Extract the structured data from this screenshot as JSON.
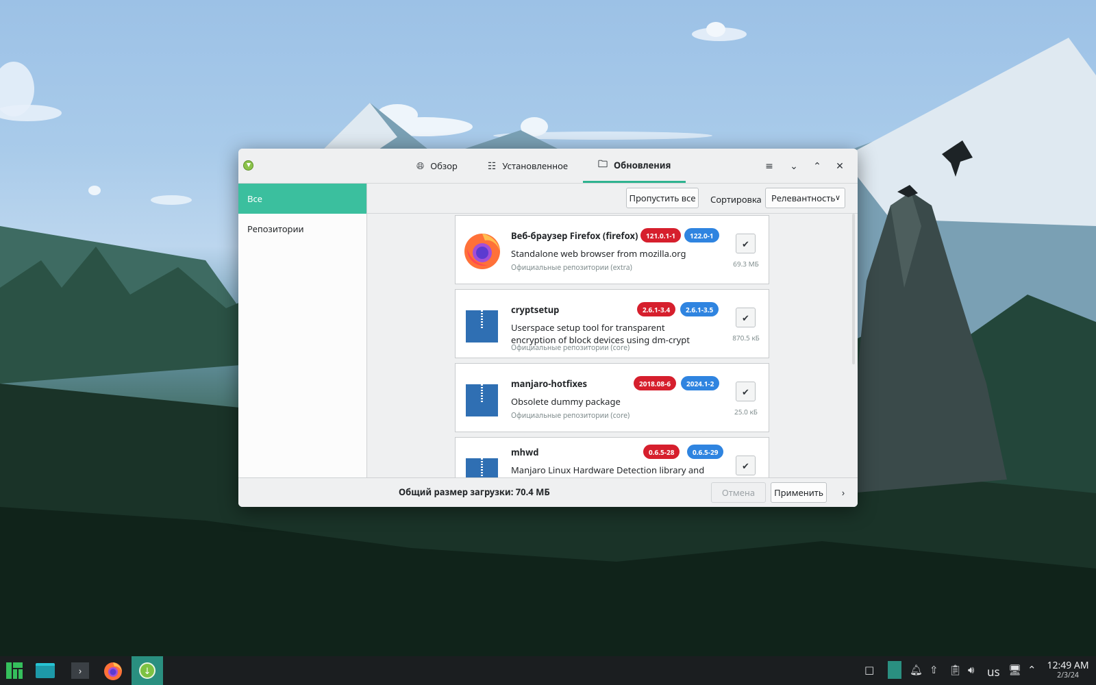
{
  "window": {
    "tabs": [
      {
        "label": "Обзор",
        "icon": "globe-icon"
      },
      {
        "label": "Установленное",
        "icon": "list-icon"
      },
      {
        "label": "Обновления",
        "icon": "folder-update-icon"
      }
    ],
    "active_tab": "Обновления"
  },
  "sidebar": {
    "items": [
      {
        "label": "Все",
        "active": true
      },
      {
        "label": "Репозитории",
        "active": false
      }
    ]
  },
  "toolbar": {
    "skip_all_label": "Пропустить все",
    "sort_label": "Сортировка",
    "sort_value": "Релевантность"
  },
  "packages": [
    {
      "name": "Веб-браузер Firefox (firefox)",
      "old_version": "121.0.1-1",
      "new_version": "122.0-1",
      "description": "Standalone web browser from mozilla.org",
      "repo": "Официальные репозитории (extra)",
      "size": "69.3 МБ",
      "icon": "firefox-icon",
      "checked": true
    },
    {
      "name": "cryptsetup",
      "old_version": "2.6.1-3.4",
      "new_version": "2.6.1-3.5",
      "description": "Userspace setup tool for transparent encryption of block devices using dm-crypt",
      "repo": "Официальные репозитории (core)",
      "size": "870.5 кБ",
      "icon": "package-archive-icon",
      "checked": true
    },
    {
      "name": "manjaro-hotfixes",
      "old_version": "2018.08-6",
      "new_version": "2024.1-2",
      "description": "Obsolete dummy package",
      "repo": "Официальные репозитории (core)",
      "size": "25.0 кБ",
      "icon": "package-archive-icon",
      "checked": true
    },
    {
      "name": "mhwd",
      "old_version": "0.6.5-28",
      "new_version": "0.6.5-29",
      "description": "Manjaro Linux Hardware Detection library and",
      "repo": "",
      "size": "",
      "icon": "package-archive-icon",
      "checked": true
    }
  ],
  "footer": {
    "total_label": "Общий размер загрузки: 70.4 МБ",
    "cancel_label": "Отмена",
    "apply_label": "Применить"
  },
  "taskbar": {
    "keyboard_layout": "us",
    "time": "12:49 AM",
    "date": "2/3/24"
  },
  "colors": {
    "accent": "#3bbf9e",
    "old_version_badge": "#d61f2d",
    "new_version_badge": "#2f84e0"
  }
}
